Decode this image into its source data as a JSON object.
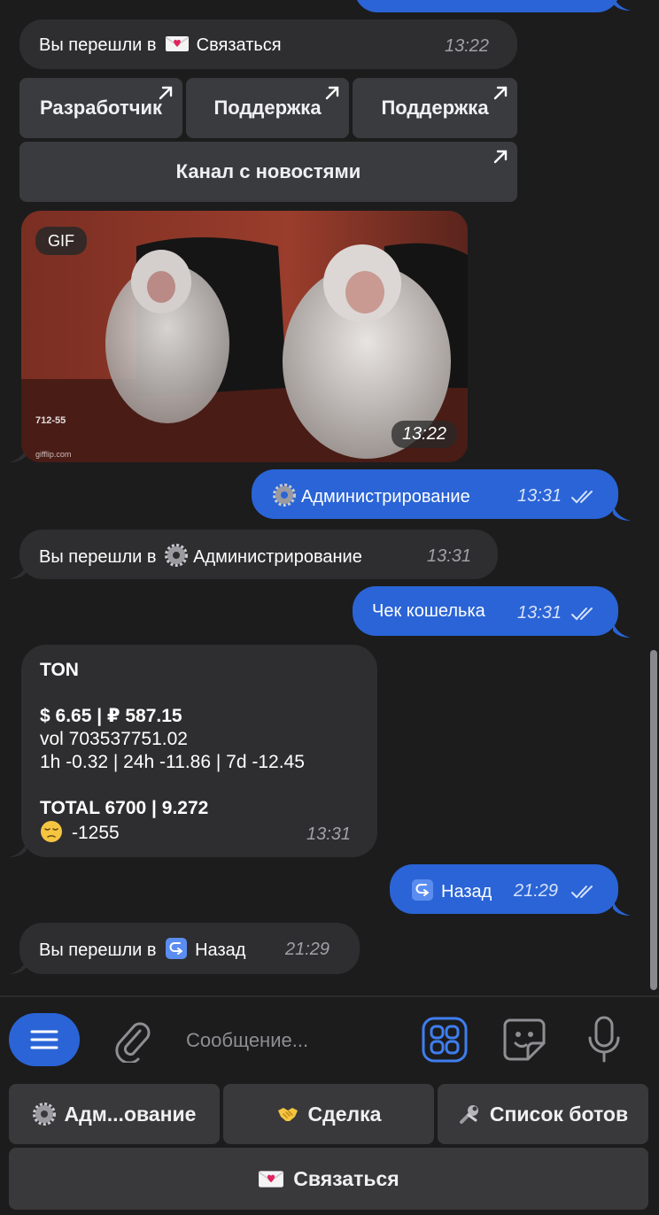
{
  "messages": {
    "m1_text": "Вы перешли в",
    "m1_target": "Связаться",
    "m1_time": "13:22",
    "inline_buttons": [
      "Разработчик",
      "Поддержка",
      "Поддержка",
      "Канал с новостями"
    ],
    "gif_badge": "GIF",
    "gif_time": "13:22",
    "out1_text": "Администрирование",
    "out1_time": "13:31",
    "m2_text": "Вы перешли в",
    "m2_target": "Администрирование",
    "m2_time": "13:31",
    "out2_text": "Чек кошелька",
    "out2_time": "13:31",
    "ton": {
      "title": "TON",
      "price": "$ 6.65  |  ₽ 587.15",
      "vol": "vol 703537751.02",
      "changes": "1h -0.32  |  24h -11.86  |  7d -12.45",
      "total": "TOTAL 6700  |  9.272",
      "pnl": "-1255",
      "time": "13:31"
    },
    "out3_text": "Назад",
    "out3_time": "21:29",
    "m3_text": "Вы перешли в",
    "m3_target": "Назад",
    "m3_time": "21:29"
  },
  "composer": {
    "placeholder": "Сообщение..."
  },
  "keyboard": {
    "admin": "Адм...ование",
    "deal": "Сделка",
    "bots": "Список ботов",
    "contact": "Связаться"
  },
  "colors": {
    "outgoing": "#2a64d6",
    "incoming": "#2e2e30",
    "background": "#1c1c1d"
  }
}
